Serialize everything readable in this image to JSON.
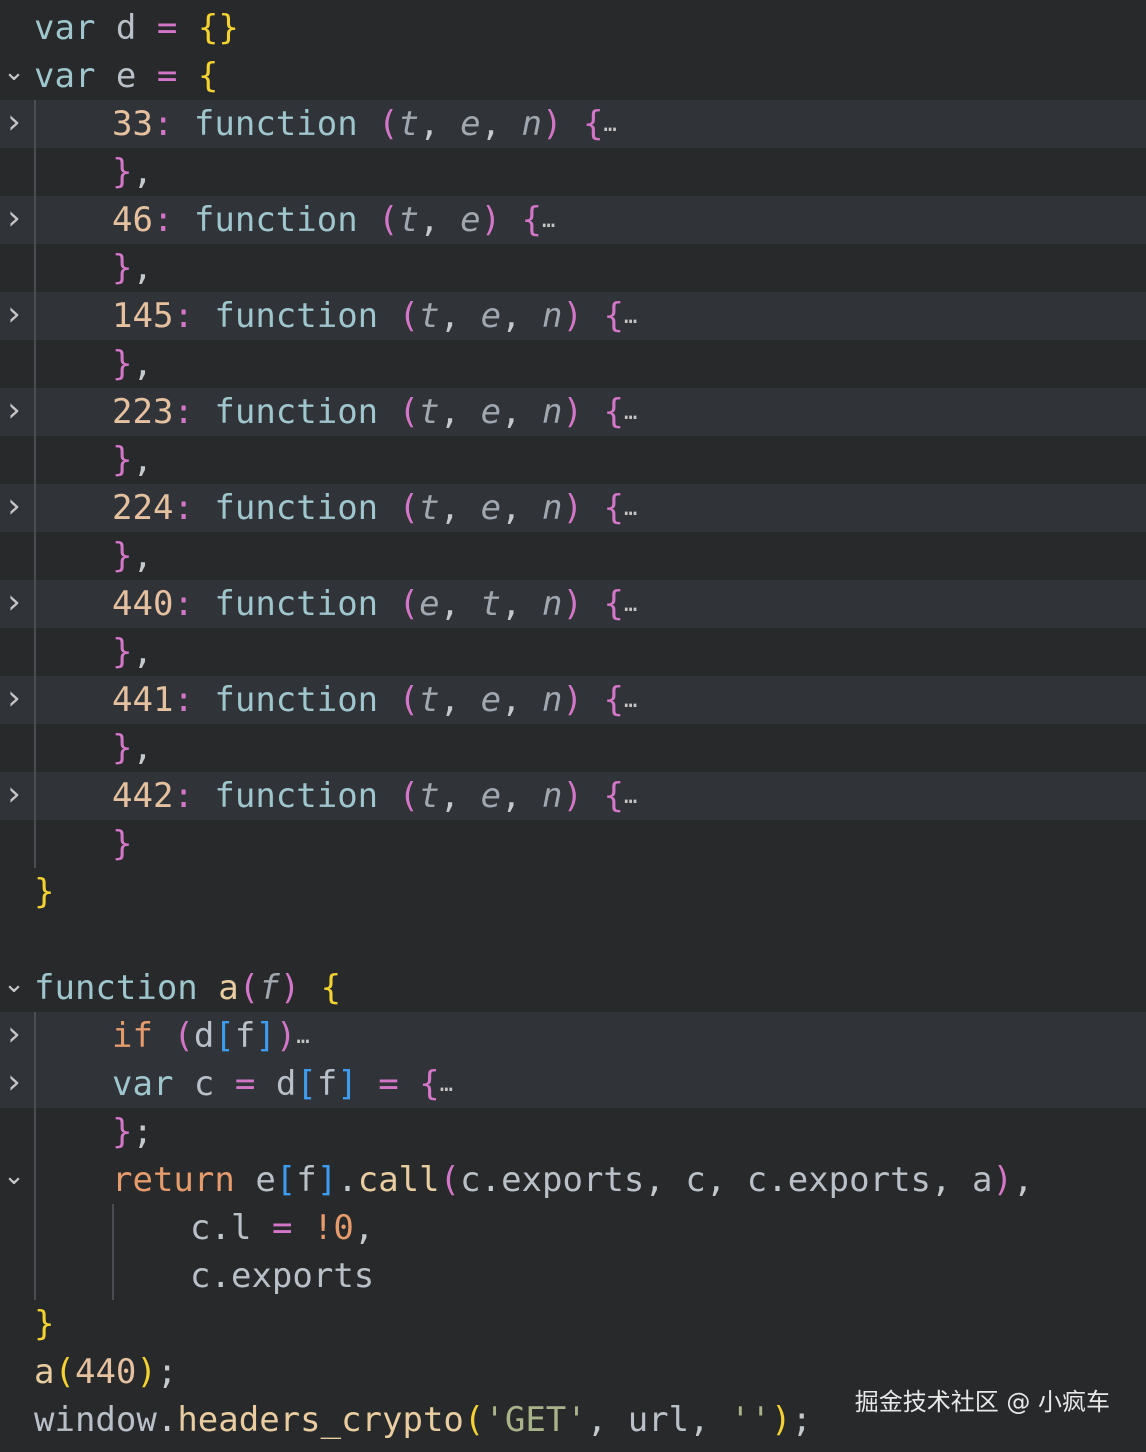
{
  "editor": {
    "lines": [
      {
        "fold": "",
        "tokens": [
          [
            "kw",
            "var"
          ],
          [
            "plain",
            " "
          ],
          [
            "id",
            "d"
          ],
          [
            "plain",
            " "
          ],
          [
            "op",
            "="
          ],
          [
            "plain",
            " "
          ],
          [
            "br-y",
            "{}"
          ]
        ]
      },
      {
        "fold": "v",
        "tokens": [
          [
            "kw",
            "var"
          ],
          [
            "plain",
            " "
          ],
          [
            "id",
            "e"
          ],
          [
            "plain",
            " "
          ],
          [
            "op",
            "="
          ],
          [
            "plain",
            " "
          ],
          [
            "br-y",
            "{"
          ]
        ]
      },
      {
        "fold": ">",
        "tokens": [
          [
            "num",
            "33"
          ],
          [
            "op",
            ":"
          ],
          [
            "plain",
            " "
          ],
          [
            "kw",
            "function"
          ],
          [
            "plain",
            " "
          ],
          [
            "op",
            "("
          ],
          [
            "param",
            "t"
          ],
          [
            "plain",
            ", "
          ],
          [
            "param",
            "e"
          ],
          [
            "plain",
            ", "
          ],
          [
            "param",
            "n"
          ],
          [
            "op",
            ")"
          ],
          [
            "plain",
            " "
          ],
          [
            "br-p",
            "{"
          ],
          [
            "dots",
            "…"
          ]
        ]
      },
      {
        "fold": "",
        "tokens": [
          [
            "br-p",
            "}"
          ],
          [
            "plain",
            ","
          ]
        ]
      },
      {
        "fold": ">",
        "tokens": [
          [
            "num",
            "46"
          ],
          [
            "op",
            ":"
          ],
          [
            "plain",
            " "
          ],
          [
            "kw",
            "function"
          ],
          [
            "plain",
            " "
          ],
          [
            "op",
            "("
          ],
          [
            "param",
            "t"
          ],
          [
            "plain",
            ", "
          ],
          [
            "param",
            "e"
          ],
          [
            "op",
            ")"
          ],
          [
            "plain",
            " "
          ],
          [
            "br-p",
            "{"
          ],
          [
            "dots",
            "…"
          ]
        ]
      },
      {
        "fold": "",
        "tokens": [
          [
            "br-p",
            "}"
          ],
          [
            "plain",
            ","
          ]
        ]
      },
      {
        "fold": ">",
        "tokens": [
          [
            "num",
            "145"
          ],
          [
            "op",
            ":"
          ],
          [
            "plain",
            " "
          ],
          [
            "kw",
            "function"
          ],
          [
            "plain",
            " "
          ],
          [
            "op",
            "("
          ],
          [
            "param",
            "t"
          ],
          [
            "plain",
            ", "
          ],
          [
            "param",
            "e"
          ],
          [
            "plain",
            ", "
          ],
          [
            "param",
            "n"
          ],
          [
            "op",
            ")"
          ],
          [
            "plain",
            " "
          ],
          [
            "br-p",
            "{"
          ],
          [
            "dots",
            "…"
          ]
        ]
      },
      {
        "fold": "",
        "tokens": [
          [
            "br-p",
            "}"
          ],
          [
            "plain",
            ","
          ]
        ]
      },
      {
        "fold": ">",
        "tokens": [
          [
            "num",
            "223"
          ],
          [
            "op",
            ":"
          ],
          [
            "plain",
            " "
          ],
          [
            "kw",
            "function"
          ],
          [
            "plain",
            " "
          ],
          [
            "op",
            "("
          ],
          [
            "param",
            "t"
          ],
          [
            "plain",
            ", "
          ],
          [
            "param",
            "e"
          ],
          [
            "plain",
            ", "
          ],
          [
            "param",
            "n"
          ],
          [
            "op",
            ")"
          ],
          [
            "plain",
            " "
          ],
          [
            "br-p",
            "{"
          ],
          [
            "dots",
            "…"
          ]
        ]
      },
      {
        "fold": "",
        "tokens": [
          [
            "br-p",
            "}"
          ],
          [
            "plain",
            ","
          ]
        ]
      },
      {
        "fold": ">",
        "tokens": [
          [
            "num",
            "224"
          ],
          [
            "op",
            ":"
          ],
          [
            "plain",
            " "
          ],
          [
            "kw",
            "function"
          ],
          [
            "plain",
            " "
          ],
          [
            "op",
            "("
          ],
          [
            "param",
            "t"
          ],
          [
            "plain",
            ", "
          ],
          [
            "param",
            "e"
          ],
          [
            "plain",
            ", "
          ],
          [
            "param",
            "n"
          ],
          [
            "op",
            ")"
          ],
          [
            "plain",
            " "
          ],
          [
            "br-p",
            "{"
          ],
          [
            "dots",
            "…"
          ]
        ]
      },
      {
        "fold": "",
        "tokens": [
          [
            "br-p",
            "}"
          ],
          [
            "plain",
            ","
          ]
        ]
      },
      {
        "fold": ">",
        "tokens": [
          [
            "num",
            "440"
          ],
          [
            "op",
            ":"
          ],
          [
            "plain",
            " "
          ],
          [
            "kw",
            "function"
          ],
          [
            "plain",
            " "
          ],
          [
            "op",
            "("
          ],
          [
            "param",
            "e"
          ],
          [
            "plain",
            ", "
          ],
          [
            "param",
            "t"
          ],
          [
            "plain",
            ", "
          ],
          [
            "param",
            "n"
          ],
          [
            "op",
            ")"
          ],
          [
            "plain",
            " "
          ],
          [
            "br-p",
            "{"
          ],
          [
            "dots",
            "…"
          ]
        ]
      },
      {
        "fold": "",
        "tokens": [
          [
            "br-p",
            "}"
          ],
          [
            "plain",
            ","
          ]
        ]
      },
      {
        "fold": ">",
        "tokens": [
          [
            "num",
            "441"
          ],
          [
            "op",
            ":"
          ],
          [
            "plain",
            " "
          ],
          [
            "kw",
            "function"
          ],
          [
            "plain",
            " "
          ],
          [
            "op",
            "("
          ],
          [
            "param",
            "t"
          ],
          [
            "plain",
            ", "
          ],
          [
            "param",
            "e"
          ],
          [
            "plain",
            ", "
          ],
          [
            "param",
            "n"
          ],
          [
            "op",
            ")"
          ],
          [
            "plain",
            " "
          ],
          [
            "br-p",
            "{"
          ],
          [
            "dots",
            "…"
          ]
        ]
      },
      {
        "fold": "",
        "tokens": [
          [
            "br-p",
            "}"
          ],
          [
            "plain",
            ","
          ]
        ]
      },
      {
        "fold": ">",
        "tokens": [
          [
            "num",
            "442"
          ],
          [
            "op",
            ":"
          ],
          [
            "plain",
            " "
          ],
          [
            "kw",
            "function"
          ],
          [
            "plain",
            " "
          ],
          [
            "op",
            "("
          ],
          [
            "param",
            "t"
          ],
          [
            "plain",
            ", "
          ],
          [
            "param",
            "e"
          ],
          [
            "plain",
            ", "
          ],
          [
            "param",
            "n"
          ],
          [
            "op",
            ")"
          ],
          [
            "plain",
            " "
          ],
          [
            "br-p",
            "{"
          ],
          [
            "dots",
            "…"
          ]
        ]
      },
      {
        "fold": "",
        "tokens": [
          [
            "br-p",
            "}"
          ]
        ]
      },
      {
        "fold": "",
        "tokens": [
          [
            "br-y",
            "}"
          ]
        ]
      },
      {
        "fold": "",
        "tokens": []
      },
      {
        "fold": "v",
        "tokens": [
          [
            "kw",
            "function"
          ],
          [
            "plain",
            " "
          ],
          [
            "fn",
            "a"
          ],
          [
            "op",
            "("
          ],
          [
            "param",
            "f"
          ],
          [
            "op",
            ")"
          ],
          [
            "plain",
            " "
          ],
          [
            "br-y",
            "{"
          ]
        ]
      },
      {
        "fold": ">",
        "tokens": [
          [
            "ctrl",
            "if"
          ],
          [
            "plain",
            " "
          ],
          [
            "op",
            "("
          ],
          [
            "id",
            "d"
          ],
          [
            "br-b",
            "["
          ],
          [
            "id",
            "f"
          ],
          [
            "br-b",
            "]"
          ],
          [
            "op",
            ")"
          ],
          [
            "dots",
            "…"
          ]
        ]
      },
      {
        "fold": ">",
        "tokens": [
          [
            "kw",
            "var"
          ],
          [
            "plain",
            " "
          ],
          [
            "id",
            "c"
          ],
          [
            "plain",
            " "
          ],
          [
            "op",
            "="
          ],
          [
            "plain",
            " "
          ],
          [
            "id",
            "d"
          ],
          [
            "br-b",
            "["
          ],
          [
            "id",
            "f"
          ],
          [
            "br-b",
            "]"
          ],
          [
            "plain",
            " "
          ],
          [
            "op",
            "="
          ],
          [
            "plain",
            " "
          ],
          [
            "br-p",
            "{"
          ],
          [
            "dots",
            "…"
          ]
        ]
      },
      {
        "fold": "",
        "tokens": [
          [
            "br-p",
            "}"
          ],
          [
            "plain",
            ";"
          ]
        ]
      },
      {
        "fold": "v",
        "tokens": [
          [
            "ctrl",
            "return"
          ],
          [
            "plain",
            " "
          ],
          [
            "id",
            "e"
          ],
          [
            "br-b",
            "["
          ],
          [
            "id",
            "f"
          ],
          [
            "br-b",
            "]"
          ],
          [
            "plain",
            "."
          ],
          [
            "fn",
            "call"
          ],
          [
            "op",
            "("
          ],
          [
            "id",
            "c"
          ],
          [
            "plain",
            "."
          ],
          [
            "id",
            "exports"
          ],
          [
            "plain",
            ", "
          ],
          [
            "id",
            "c"
          ],
          [
            "plain",
            ", "
          ],
          [
            "id",
            "c"
          ],
          [
            "plain",
            "."
          ],
          [
            "id",
            "exports"
          ],
          [
            "plain",
            ", "
          ],
          [
            "id",
            "a"
          ],
          [
            "op",
            ")"
          ],
          [
            "plain",
            ","
          ]
        ]
      },
      {
        "fold": "",
        "tokens": [
          [
            "id",
            "c"
          ],
          [
            "plain",
            "."
          ],
          [
            "id",
            "l"
          ],
          [
            "plain",
            " "
          ],
          [
            "op",
            "="
          ],
          [
            "plain",
            " "
          ],
          [
            "ctrl",
            "!0"
          ],
          [
            "plain",
            ","
          ]
        ]
      },
      {
        "fold": "",
        "tokens": [
          [
            "id",
            "c"
          ],
          [
            "plain",
            "."
          ],
          [
            "id",
            "exports"
          ]
        ]
      },
      {
        "fold": "",
        "tokens": [
          [
            "br-y",
            "}"
          ]
        ]
      },
      {
        "fold": "",
        "tokens": [
          [
            "fn",
            "a"
          ],
          [
            "br-y",
            "("
          ],
          [
            "num",
            "440"
          ],
          [
            "br-y",
            ")"
          ],
          [
            "plain",
            ";"
          ]
        ]
      },
      {
        "fold": "",
        "tokens": [
          [
            "id",
            "window"
          ],
          [
            "plain",
            "."
          ],
          [
            "fn",
            "headers_crypto"
          ],
          [
            "br-y",
            "("
          ],
          [
            "str",
            "'GET'"
          ],
          [
            "plain",
            ", "
          ],
          [
            "id",
            "url"
          ],
          [
            "plain",
            ", "
          ],
          [
            "str",
            "''"
          ],
          [
            "br-y",
            ")"
          ],
          [
            "plain",
            ";"
          ]
        ]
      }
    ]
  },
  "watermark": "掘金技术社区 @ 小疯车"
}
